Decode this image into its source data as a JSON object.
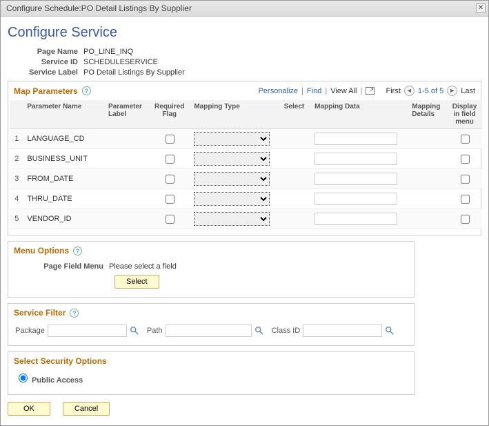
{
  "window": {
    "title": "Configure Schedule:PO Detail Listings By Supplier"
  },
  "page": {
    "heading": "Configure Service",
    "fields": {
      "page_name": {
        "label": "Page Name",
        "value": "PO_LINE_INQ"
      },
      "service_id": {
        "label": "Service ID",
        "value": "SCHEDULESERVICE"
      },
      "service_label": {
        "label": "Service Label",
        "value": "PO Detail Listings By Supplier"
      }
    }
  },
  "map_parameters": {
    "title": "Map Parameters",
    "tools": {
      "personalize": "Personalize",
      "find": "Find",
      "view_all": "View All",
      "popout_icon": "popout",
      "first": "First",
      "counter": "1-5 of 5",
      "last": "Last"
    },
    "columns": {
      "seq": "",
      "parameter_name": "Parameter Name",
      "parameter_label": "Parameter Label",
      "required_flag": "Required Flag",
      "mapping_type": "Mapping Type",
      "select": "Select",
      "mapping_data": "Mapping Data",
      "mapping_details": "Mapping Details",
      "display_in_field_menu": "Display in field menu"
    },
    "rows": [
      {
        "seq": "1",
        "parameter_name": "LANGUAGE_CD",
        "parameter_label": "",
        "required_flag": false,
        "mapping_type": "",
        "select": "",
        "mapping_data": "",
        "mapping_details": "",
        "display_in_field_menu": false
      },
      {
        "seq": "2",
        "parameter_name": "BUSINESS_UNIT",
        "parameter_label": "",
        "required_flag": false,
        "mapping_type": "",
        "select": "",
        "mapping_data": "",
        "mapping_details": "",
        "display_in_field_menu": false
      },
      {
        "seq": "3",
        "parameter_name": "FROM_DATE",
        "parameter_label": "",
        "required_flag": false,
        "mapping_type": "",
        "select": "",
        "mapping_data": "",
        "mapping_details": "",
        "display_in_field_menu": false
      },
      {
        "seq": "4",
        "parameter_name": "THRU_DATE",
        "parameter_label": "",
        "required_flag": false,
        "mapping_type": "",
        "select": "",
        "mapping_data": "",
        "mapping_details": "",
        "display_in_field_menu": false
      },
      {
        "seq": "5",
        "parameter_name": "VENDOR_ID",
        "parameter_label": "",
        "required_flag": false,
        "mapping_type": "",
        "select": "",
        "mapping_data": "",
        "mapping_details": "",
        "display_in_field_menu": false
      }
    ]
  },
  "menu_options": {
    "title": "Menu Options",
    "field_menu_label": "Page Field Menu",
    "field_menu_value": "Please select a field",
    "select_btn": "Select"
  },
  "service_filter": {
    "title": "Service Filter",
    "package_label": "Package",
    "package_value": "",
    "path_label": "Path",
    "path_value": "",
    "classid_label": "Class ID",
    "classid_value": ""
  },
  "security": {
    "title": "Select Security Options",
    "public_access": "Public Access"
  },
  "buttons": {
    "ok": "OK",
    "cancel": "Cancel"
  }
}
